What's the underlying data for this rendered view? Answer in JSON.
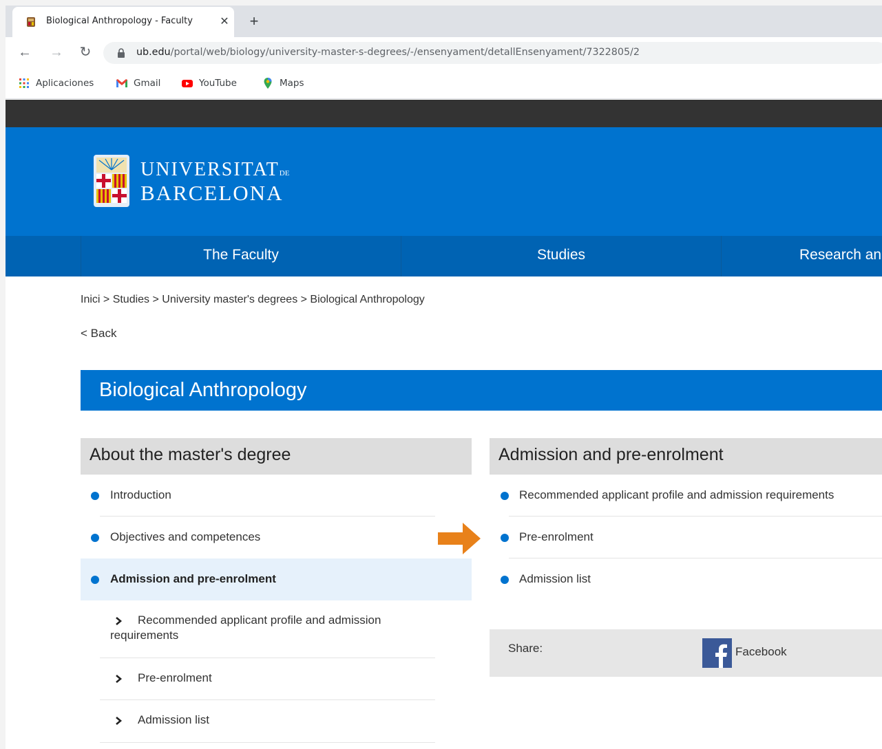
{
  "browser": {
    "tab_title": "Biological Anthropology - Faculty",
    "url_host": "ub.edu",
    "url_path": "/portal/web/biology/university-master-s-degrees/-/ensenyament/detallEnsenyament/7322805/2",
    "bookmarks": [
      "Aplicaciones",
      "Gmail",
      "YouTube",
      "Maps"
    ]
  },
  "site": {
    "logo_line1": "UNIVERSITAT",
    "logo_de": "DE",
    "logo_line2": "BARCELONA",
    "nav": [
      "The Faculty",
      "Studies",
      "Research and"
    ],
    "breadcrumb": "Inici > Studies > University master's degrees > Biological Anthropology",
    "back": "< Back",
    "page_title": "Biological Anthropology"
  },
  "left_panel": {
    "title": "About the master's degree",
    "items": [
      "Introduction",
      "Objectives and competences",
      "Admission and pre-enrolment"
    ],
    "subitems": [
      "Recommended applicant profile and admission requirements",
      "Pre-enrolment",
      "Admission list"
    ]
  },
  "right_panel": {
    "title": "Admission and pre-enrolment",
    "items": [
      "Recommended applicant profile and admission requirements",
      "Pre-enrolment",
      "Admission list"
    ]
  },
  "share": {
    "label": "Share:",
    "facebook": "Facebook"
  },
  "colors": {
    "brand_blue": "#0073cf",
    "nav_blue": "#0063b3",
    "topbar": "#333333",
    "highlight_arrow": "#e8811a"
  }
}
